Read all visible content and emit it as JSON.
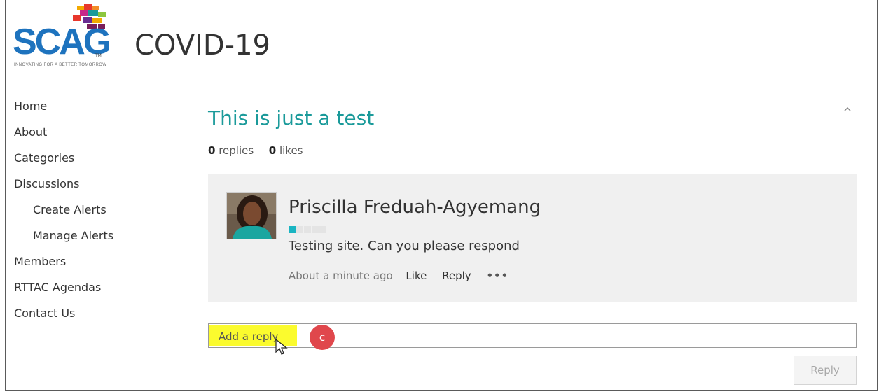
{
  "header": {
    "logo_text": "SCAG",
    "logo_tagline": "INNOVATING FOR A BETTER TOMORROW",
    "logo_trademark": "TM",
    "site_title": "COVID-19"
  },
  "nav": {
    "items": [
      {
        "label": "Home"
      },
      {
        "label": "About"
      },
      {
        "label": "Categories"
      },
      {
        "label": "Discussions"
      },
      {
        "label": "Create Alerts"
      },
      {
        "label": "Manage Alerts"
      },
      {
        "label": "Members"
      },
      {
        "label": "RTTAC Agendas"
      },
      {
        "label": "Contact Us"
      }
    ]
  },
  "post": {
    "title": "This is just a test",
    "replies_count": "0",
    "replies_label": "replies",
    "likes_count": "0",
    "likes_label": "likes",
    "collapse_icon": "chevron-up-icon"
  },
  "comment": {
    "author": "Priscilla Freduah-Agyemang",
    "level_filled": 1,
    "level_total": 5,
    "level_color": "#1ab5c2",
    "message": "Testing site. Can you please respond",
    "time": "About a minute ago",
    "like_label": "Like",
    "reply_label": "Reply",
    "more_label": "•••"
  },
  "reply_box": {
    "placeholder": "Add a reply",
    "marker_label": "c",
    "submit_label": "Reply"
  },
  "colors": {
    "accent": "#1a9a9a",
    "highlight": "#fbfb2e",
    "marker": "#e0474c"
  }
}
